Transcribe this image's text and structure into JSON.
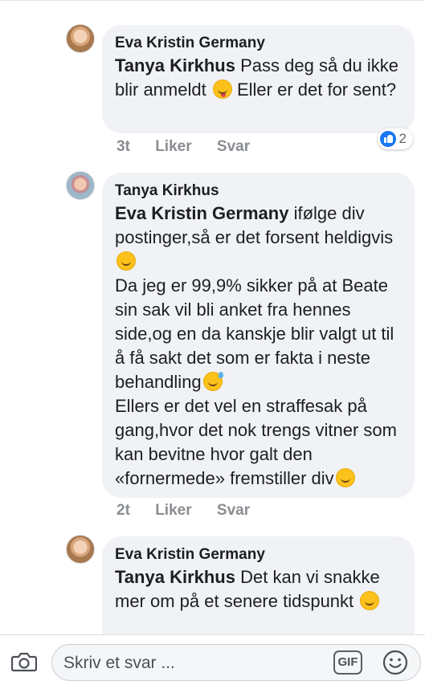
{
  "comments": [
    {
      "author": "Eva Kristin Germany",
      "mention": "Tanya Kirkhus",
      "text": "Pass deg så du ikke blir anmeldt",
      "text_after_emoji": "Eller er det for sent?",
      "time": "3t",
      "like_label": "Liker",
      "reply_label": "Svar",
      "reaction_count": "2"
    },
    {
      "author": "Tanya Kirkhus",
      "mention": "Eva Kristin Germany",
      "line1": "ifølge div postinger,så er det forsent heldigvis",
      "line2": "Da jeg er 99,9% sikker på at Beate sin sak vil bli anket fra hennes side,og en da kanskje blir valgt ut til å få sakt det som er fakta i neste behandling",
      "line3": "Ellers er det vel en straffesak på gang,hvor det nok trengs vitner som kan bevitne hvor galt den «fornermede» fremstiller div",
      "time": "2t",
      "like_label": "Liker",
      "reply_label": "Svar"
    },
    {
      "author": "Eva Kristin Germany",
      "mention": "Tanya Kirkhus",
      "text": "Det kan vi snakke mer om på et senere tidspunkt"
    }
  ],
  "composer": {
    "placeholder": "Skriv et svar ...",
    "gif_label": "GIF"
  },
  "colors": {
    "bubble": "#f0f2f5",
    "like_blue": "#1877f2",
    "meta_gray": "#8a8d91"
  }
}
